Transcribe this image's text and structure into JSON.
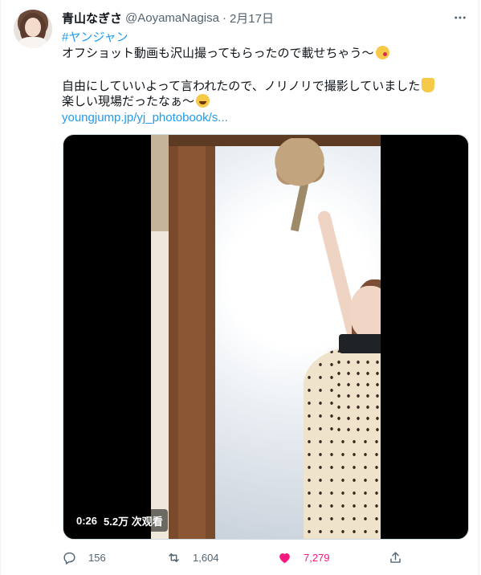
{
  "tweet": {
    "display_name": "青山なぎさ",
    "handle": "@AoyamaNagisa",
    "separator": "·",
    "date": "2月17日",
    "hashtag": "#ヤンジャン",
    "line1": "オフショット動画も沢山撮ってもらったので載せちゃう〜",
    "line2": "自由にしていいよって言われたので、ノリノリで撮影していました",
    "line3": "楽しい現場だったなぁ〜",
    "link": "youngjump.jp/yj_photobook/s..."
  },
  "video": {
    "duration": "0:26",
    "views": "5.2万 次观看"
  },
  "actions": {
    "replies": "156",
    "retweets": "1,604",
    "likes": "7,279"
  },
  "colors": {
    "accent": "#1d9bf0",
    "like": "#f91880",
    "muted": "#536471"
  },
  "icons": {
    "more": "more-horizontal-icon",
    "reply": "reply-icon",
    "retweet": "retweet-icon",
    "like": "heart-filled-icon",
    "share": "share-icon",
    "emoji1": "kissing-face-emoji-icon",
    "emoji2": "victory-hand-emoji-icon",
    "emoji3": "grinning-squinting-emoji-icon"
  }
}
